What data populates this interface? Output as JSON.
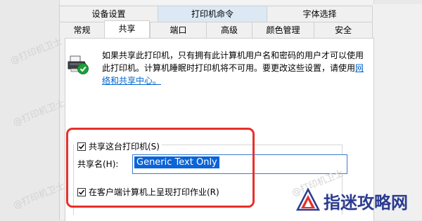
{
  "tabs_row1": [
    "设备设置",
    "打印机命令",
    "字体选择"
  ],
  "tabs_row2": [
    "常规",
    "共享",
    "端口",
    "高级",
    "颜色管理",
    "安全"
  ],
  "info": {
    "text": "如果共享此打印机，只有拥有此计算机用户名和密码的用户才可以使用此打印机。计算机睡眠时打印机将不可用。要更改这些设置，请使用",
    "link": "网络和共享中心。"
  },
  "share_checkbox": {
    "label": "共享这台打印机(S)",
    "checked": true
  },
  "share_name": {
    "label": "共享名(H):",
    "value": "Generic  Text Only"
  },
  "render_checkbox": {
    "label": "在客户端计算机上呈现打印作业(R)",
    "checked": true
  },
  "watermark": "@打印机卫士",
  "logo": {
    "text": "指迷攻略网"
  },
  "colors": {
    "highlight": "#e8302a",
    "selection": "#0a64d8",
    "link": "#0066cc"
  }
}
